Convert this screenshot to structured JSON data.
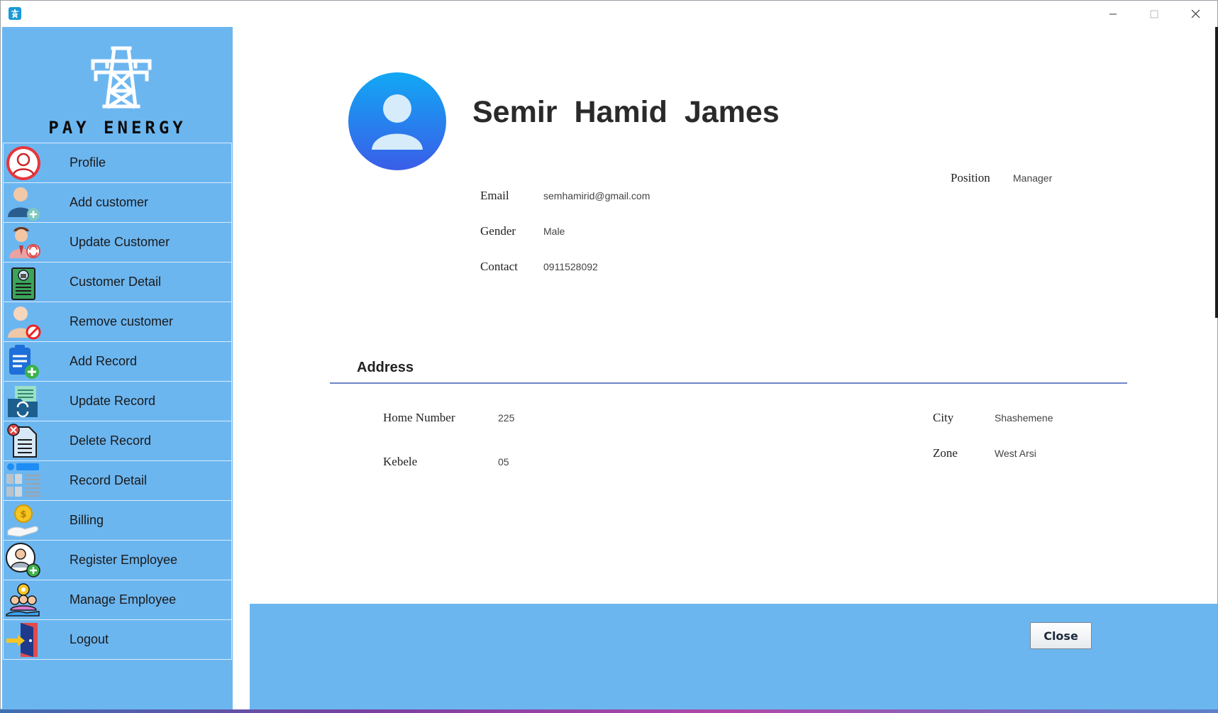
{
  "window": {
    "icons": {
      "app": "tower-icon",
      "minimize": "minimize-icon",
      "maximize": "maximize-icon",
      "close": "close-icon"
    }
  },
  "sidebar": {
    "brand_name": "PAY ENERGY",
    "brand_icon": "transmission-tower-icon",
    "items": [
      {
        "label": "Profile",
        "icon": "profile-icon"
      },
      {
        "label": "Add customer",
        "icon": "add-customer-icon"
      },
      {
        "label": "Update Customer",
        "icon": "update-customer-icon"
      },
      {
        "label": "Customer Detail",
        "icon": "customer-detail-icon"
      },
      {
        "label": "Remove customer",
        "icon": "remove-customer-icon"
      },
      {
        "label": "Add Record",
        "icon": "add-record-icon"
      },
      {
        "label": "Update Record",
        "icon": "update-record-icon"
      },
      {
        "label": "Delete Record",
        "icon": "delete-record-icon"
      },
      {
        "label": "Record Detail",
        "icon": "record-detail-icon"
      },
      {
        "label": "Billing",
        "icon": "billing-icon"
      },
      {
        "label": "Register Employee",
        "icon": "register-employee-icon"
      },
      {
        "label": "Manage Employee",
        "icon": "manage-employee-icon"
      },
      {
        "label": "Logout",
        "icon": "logout-icon"
      }
    ]
  },
  "profile": {
    "full_name": "Semir  Hamid  James",
    "avatar_icon": "user-avatar-icon",
    "email_label": "Email",
    "email": "semhamirid@gmail.com",
    "gender_label": "Gender",
    "gender": "Male",
    "contact_label": "Contact",
    "contact": "0911528092",
    "position_label": "Position",
    "position": "Manager"
  },
  "address": {
    "title": "Address",
    "home_number_label": "Home Number",
    "home_number": "225",
    "kebele_label": "Kebele",
    "kebele": "05",
    "city_label": "City",
    "city": "Shashemene",
    "zone_label": "Zone",
    "zone": "West Arsi"
  },
  "footer": {
    "close_label": "Close"
  },
  "colors": {
    "sidebar": "#6cb6f0",
    "footer": "#6cb6f0",
    "rule": "#6f86c9",
    "avatar": "#1e8df5"
  }
}
